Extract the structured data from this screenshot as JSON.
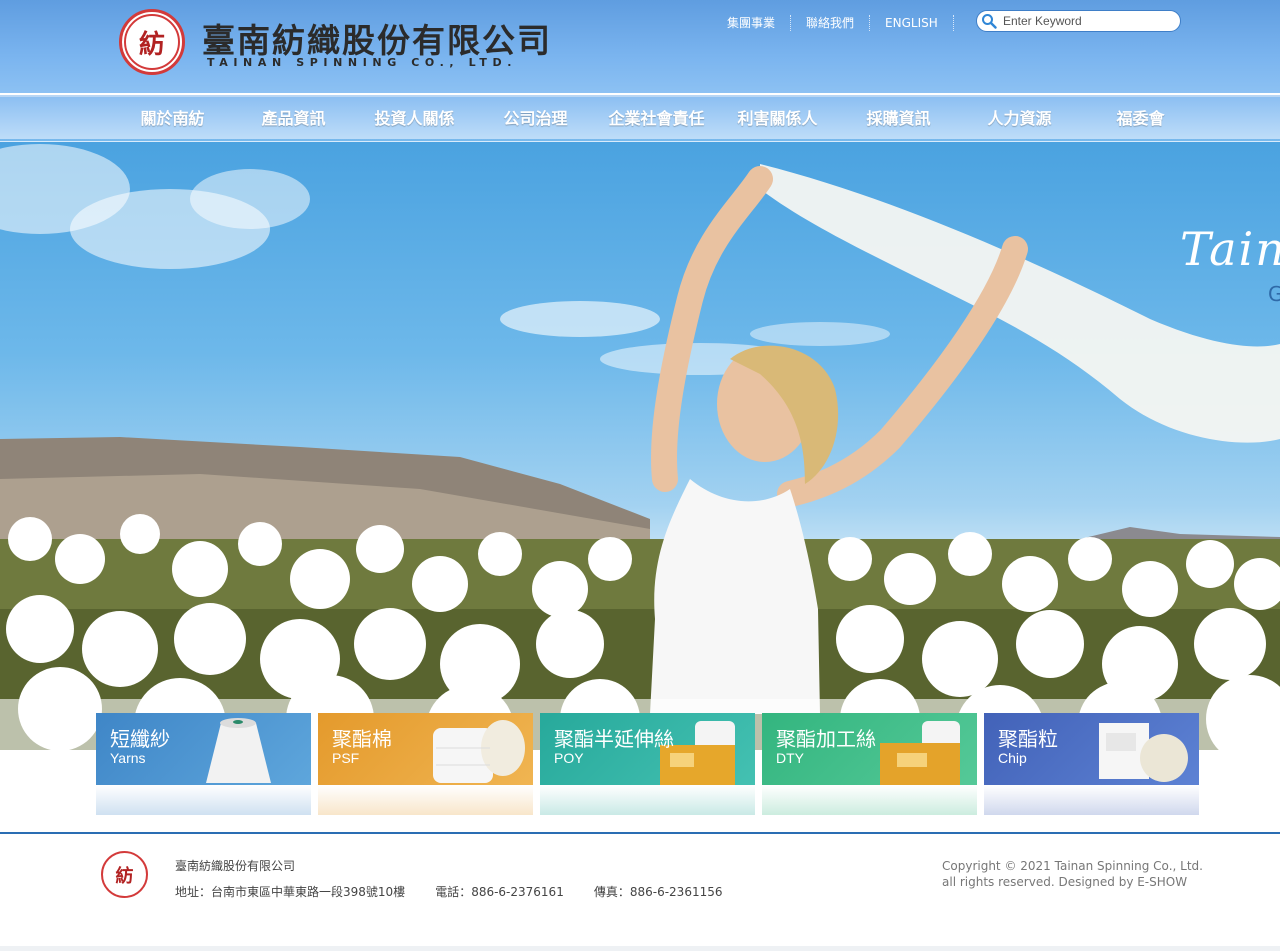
{
  "header": {
    "logo_char": "紡",
    "brand_zh": "臺南紡織股份有限公司",
    "brand_en": "TAINAN SPINNING CO., LTD.",
    "links": [
      "集團事業",
      "聯絡我們",
      "ENGLISH"
    ],
    "search_placeholder": "Enter Keyword"
  },
  "nav": {
    "items": [
      "關於南紡",
      "產品資訊",
      "投資人關係",
      "公司治理",
      "企業社會責任",
      "利害關係人",
      "採購資訊",
      "人力資源",
      "福委會"
    ]
  },
  "hero": {
    "text": "Taina",
    "sub": "G"
  },
  "products": [
    {
      "zh": "短纖紗",
      "en": "Yarns",
      "color": "#4a92cf"
    },
    {
      "zh": "聚酯棉",
      "en": "PSF",
      "color": "#e8a83a"
    },
    {
      "zh": "聚酯半延伸絲",
      "en": "POY",
      "color": "#2fb3a4"
    },
    {
      "zh": "聚酯加工絲",
      "en": "DTY",
      "color": "#3ec08a"
    },
    {
      "zh": "聚酯粒",
      "en": "Chip",
      "color": "#4a6fc4"
    }
  ],
  "footer": {
    "logo_char": "紡",
    "company": "臺南紡織股份有限公司",
    "address": "地址：台南市東區中華東路一段398號10樓",
    "phone": "電話：886-6-2376161",
    "fax": "傳真：886-6-2361156",
    "copyright_1": "Copyright © 2021 Tainan Spinning Co., Ltd.",
    "copyright_2": "all rights reserved. Designed by E-SHOW"
  }
}
